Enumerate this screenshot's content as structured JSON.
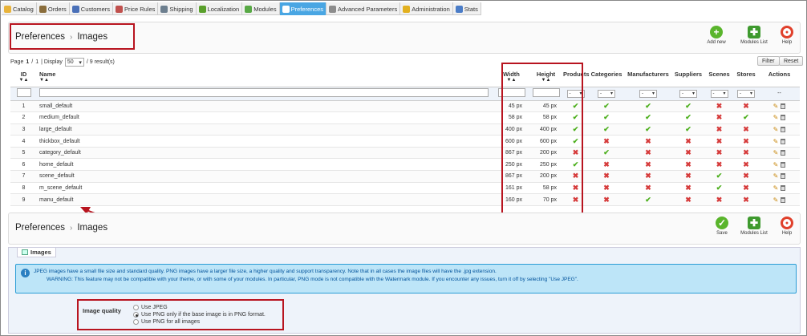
{
  "nav": {
    "tabs": [
      {
        "label": "Catalog",
        "icon": "folder-icon",
        "color": "#e8b33a",
        "active": false
      },
      {
        "label": "Orders",
        "icon": "cart-icon",
        "color": "#8a6d3b",
        "active": false
      },
      {
        "label": "Customers",
        "icon": "users-icon",
        "color": "#4a70b8",
        "active": false
      },
      {
        "label": "Price Rules",
        "icon": "tag-icon",
        "color": "#c0504d",
        "active": false
      },
      {
        "label": "Shipping",
        "icon": "truck-icon",
        "color": "#6d7f8f",
        "active": false
      },
      {
        "label": "Localization",
        "icon": "globe-icon",
        "color": "#5aa02c",
        "active": false
      },
      {
        "label": "Modules",
        "icon": "puzzle-icon",
        "color": "#58a945",
        "active": false
      },
      {
        "label": "Preferences",
        "icon": "settings-icon",
        "color": "#ffffff",
        "active": true
      },
      {
        "label": "Advanced Parameters",
        "icon": "wrench-icon",
        "color": "#8c8c8c",
        "active": false
      },
      {
        "label": "Administration",
        "icon": "key-icon",
        "color": "#e2b01f",
        "active": false
      },
      {
        "label": "Stats",
        "icon": "chart-icon",
        "color": "#4a7cc7",
        "active": false
      }
    ]
  },
  "toolbar1": {
    "breadcrumb_root": "Preferences",
    "breadcrumb_sep": "›",
    "breadcrumb_page": "Images",
    "add_label": "Add new",
    "modules_label": "Modules List",
    "help_label": "Help"
  },
  "paging": {
    "page_prefix": "Page",
    "page_current": "1",
    "page_sep": "/",
    "page_total": "1",
    "display_label": "| Display",
    "display_value": "50",
    "results_text": "/ 9 result(s)",
    "filter_label": "Filter",
    "reset_label": "Reset"
  },
  "table": {
    "headers": {
      "id": "ID",
      "name": "Name",
      "width": "Width",
      "height": "Height",
      "products": "Products",
      "categories": "Categories",
      "manufacturers": "Manufacturers",
      "suppliers": "Suppliers",
      "scenes": "Scenes",
      "stores": "Stores",
      "actions": "Actions"
    },
    "filter_select_value": "-",
    "filter_actions_text": "--",
    "rows": [
      {
        "id": "1",
        "name": "small_default",
        "width": "45 px",
        "height": "45 px",
        "flags": [
          true,
          true,
          true,
          true,
          false,
          false
        ]
      },
      {
        "id": "2",
        "name": "medium_default",
        "width": "58 px",
        "height": "58 px",
        "flags": [
          true,
          true,
          true,
          true,
          false,
          true
        ]
      },
      {
        "id": "3",
        "name": "large_default",
        "width": "400 px",
        "height": "400 px",
        "flags": [
          true,
          true,
          true,
          true,
          false,
          false
        ]
      },
      {
        "id": "4",
        "name": "thickbox_default",
        "width": "600 px",
        "height": "600 px",
        "flags": [
          true,
          false,
          false,
          false,
          false,
          false
        ]
      },
      {
        "id": "5",
        "name": "category_default",
        "width": "867 px",
        "height": "200 px",
        "flags": [
          false,
          true,
          false,
          false,
          false,
          false
        ]
      },
      {
        "id": "6",
        "name": "home_default",
        "width": "250 px",
        "height": "250 px",
        "flags": [
          true,
          false,
          false,
          false,
          false,
          false
        ]
      },
      {
        "id": "7",
        "name": "scene_default",
        "width": "867 px",
        "height": "200 px",
        "flags": [
          false,
          false,
          false,
          false,
          true,
          false
        ]
      },
      {
        "id": "8",
        "name": "m_scene_default",
        "width": "161 px",
        "height": "58 px",
        "flags": [
          false,
          false,
          false,
          false,
          true,
          false
        ]
      },
      {
        "id": "9",
        "name": "manu_default",
        "width": "160 px",
        "height": "70 px",
        "flags": [
          false,
          false,
          true,
          false,
          false,
          false
        ]
      }
    ]
  },
  "toolbar2": {
    "breadcrumb_root": "Preferences",
    "breadcrumb_sep": "›",
    "breadcrumb_page": "Images",
    "save_label": "Save",
    "modules_label": "Modules List",
    "help_label": "Help"
  },
  "images_section": {
    "legend": "Images",
    "info_line1": "JPEG images have a small file size and standard quality. PNG images have a larger file size, a higher quality and support transparency. Note that in all cases the image files will have the .jpg extension.",
    "info_line2": "WARNING: This feature may not be compatible with your theme, or with some of your modules. In particular, PNG mode is not compatible with the Watermark module. If you encounter any issues, turn it off by selecting \"Use JPEG\".",
    "quality_label": "Image quality",
    "options": [
      {
        "label": "Use JPEG",
        "selected": false
      },
      {
        "label": "Use PNG only if the base image is in PNG format.",
        "selected": true
      },
      {
        "label": "Use PNG for all images",
        "selected": false
      }
    ]
  },
  "colors": {
    "accent": "#49a6e3",
    "annotation": "#b8141f",
    "ok": "#4caf1c",
    "no": "#d63b3b"
  }
}
